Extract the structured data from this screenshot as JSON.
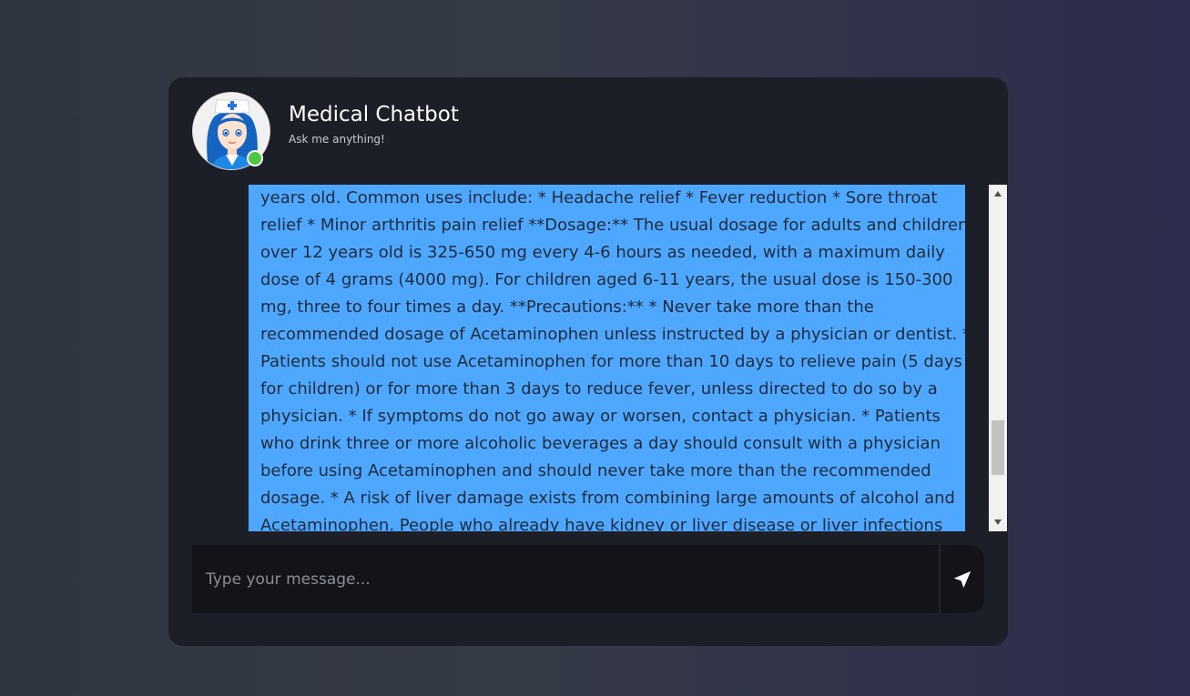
{
  "header": {
    "title": "Medical Chatbot",
    "subtitle": "Ask me anything!",
    "avatar_icon": "nurse-avatar",
    "status": "online",
    "status_color": "#4cc73f"
  },
  "messages": [
    {
      "role": "bot",
      "bubble_color": "#4fa8ff",
      "lines": [
        "years old. Common uses include: * Headache relief * Fever reduction * Sore throat",
        "relief * Minor arthritis pain relief **Dosage:** The usual dosage for adults and children",
        "over 12 years old is 325-650 mg every 4-6 hours as needed, with a maximum daily",
        "dose of 4 grams (4000 mg). For children aged 6-11 years, the usual dose is 150-300",
        "mg, three to four times a day. **Precautions:** * Never take more than the",
        "recommended dosage of Acetaminophen unless instructed by a physician or dentist. *",
        "Patients should not use Acetaminophen for more than 10 days to relieve pain (5 days",
        "for children) or for more than 3 days to reduce fever, unless directed to do so by a",
        "physician. * If symptoms do not go away or worsen, contact a physician. * Patients",
        "who drink three or more alcoholic beverages a day should consult with a physician",
        "before using Acetaminophen and should never take more than the recommended",
        "dosage. * A risk of liver damage exists from combining large amounts of alcohol and",
        "Acetaminophen. People who already have kidney or liver disease or liver infections"
      ]
    }
  ],
  "composer": {
    "placeholder": "Type your message...",
    "value": "",
    "send_icon": "send-icon"
  },
  "colors": {
    "card_bg": "#1d1f28",
    "composer_bg": "#131419",
    "accent": "#4fa8ff"
  }
}
